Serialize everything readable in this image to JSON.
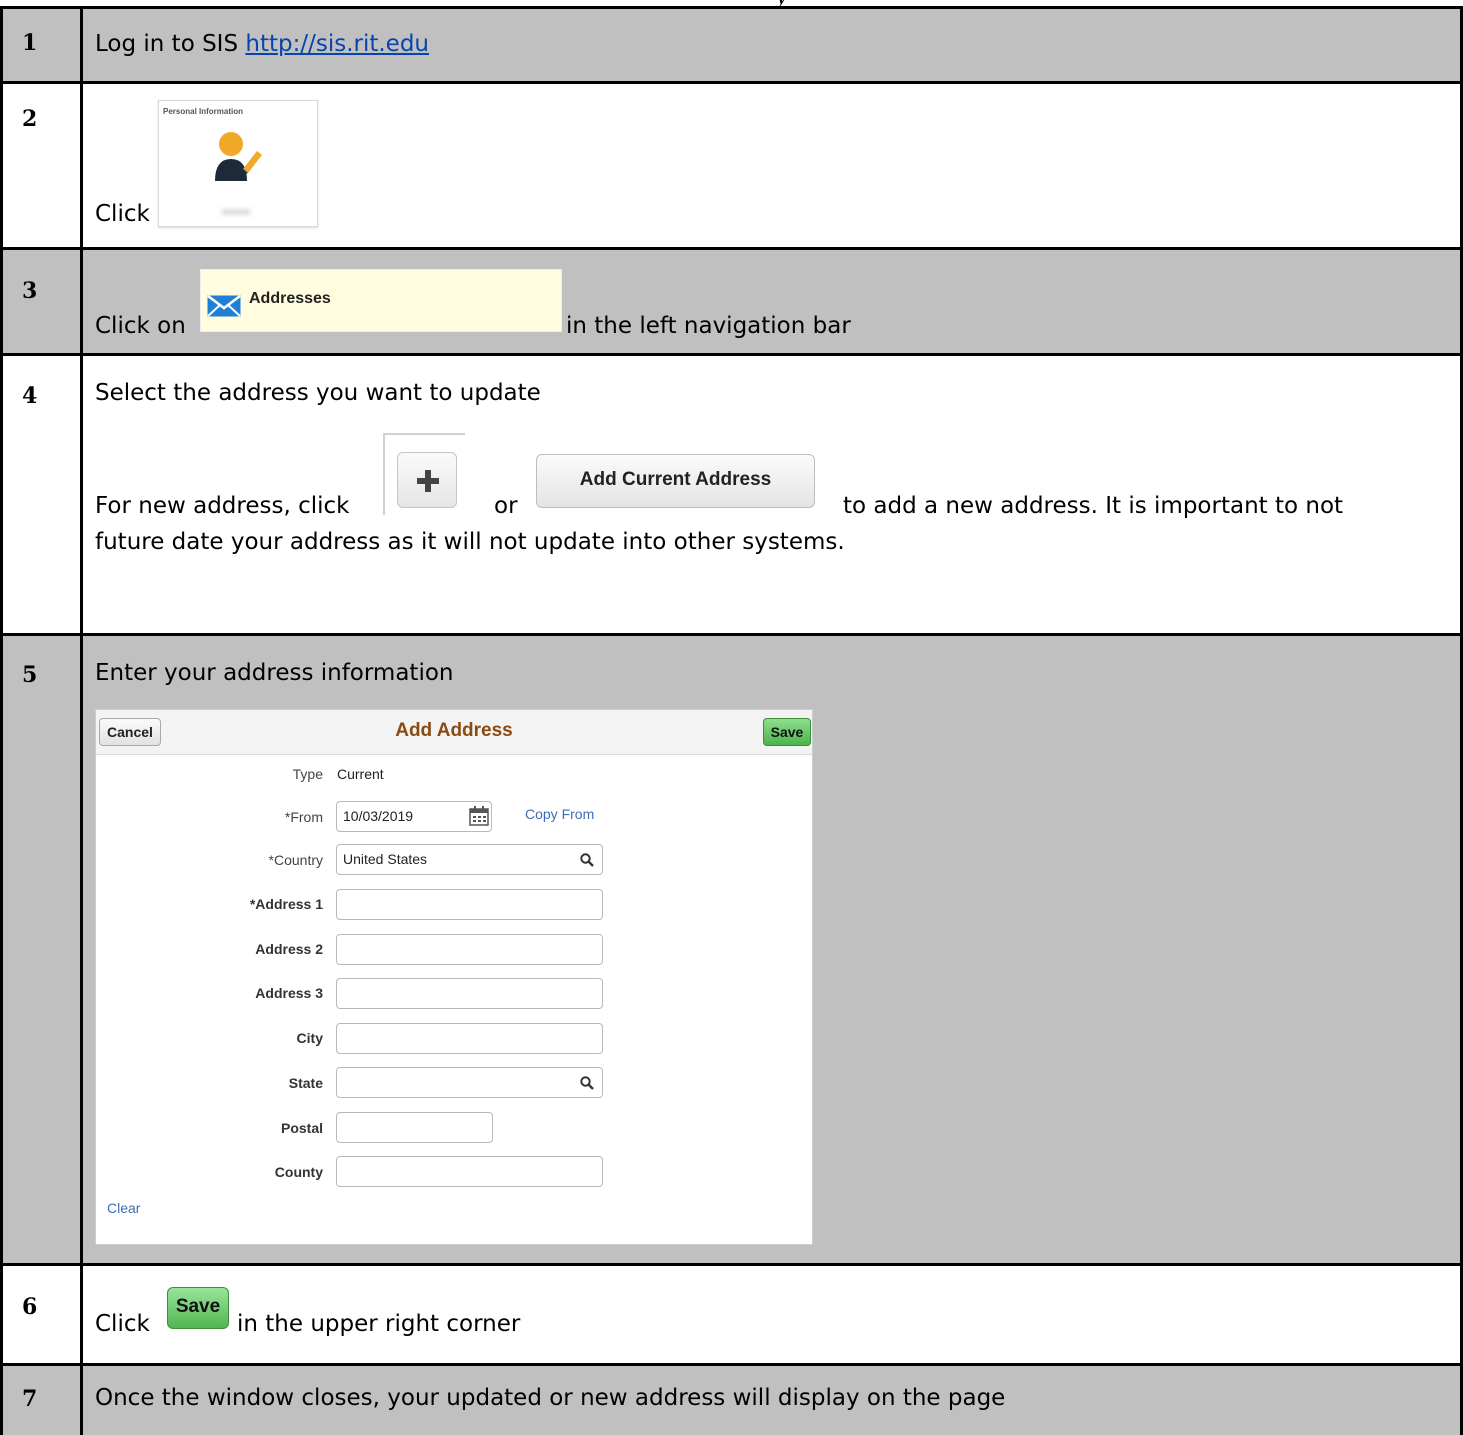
{
  "header": {
    "title_fragment": "y"
  },
  "steps": [
    {
      "num": "1",
      "text": "Log in to SIS ",
      "link": "http://sis.rit.edu"
    },
    {
      "num": "2",
      "text": "Click",
      "tile_title": "Personal Information"
    },
    {
      "num": "3",
      "text_before": "Click on",
      "button_label": "Addresses",
      "text_after": "in the left navigation bar"
    },
    {
      "num": "4",
      "line1": "Select the address you want to update",
      "line2_a": "For new address, click",
      "line2_or": "or",
      "button_label": "Add Current Address",
      "line2_b": "to add a new address. It is important to not",
      "line3": "future date your address as it will not update into other systems."
    },
    {
      "num": "5",
      "text": "Enter your address information"
    },
    {
      "num": "6",
      "text_before": "Click",
      "button_label": "Save",
      "text_after": "in the upper right corner"
    },
    {
      "num": "7",
      "text": "Once the window closes, your updated or new address will display on the page"
    }
  ],
  "form": {
    "cancel_label": "Cancel",
    "title": "Add Address",
    "save_label": "Save",
    "type_label": "Type",
    "type_value": "Current",
    "from_label": "*From",
    "from_value": "10/03/2019",
    "copy_from_label": "Copy From",
    "country_label": "*Country",
    "country_value": "United States",
    "address1_label": "*Address 1",
    "address2_label": "Address 2",
    "address3_label": "Address 3",
    "city_label": "City",
    "state_label": "State",
    "postal_label": "Postal",
    "county_label": "County",
    "clear_label": "Clear"
  },
  "colors": {
    "gray_row": "#c0c0c0",
    "form_title": "#8a4a12",
    "save_green": "#52b552",
    "link_blue": "#0645ad"
  }
}
